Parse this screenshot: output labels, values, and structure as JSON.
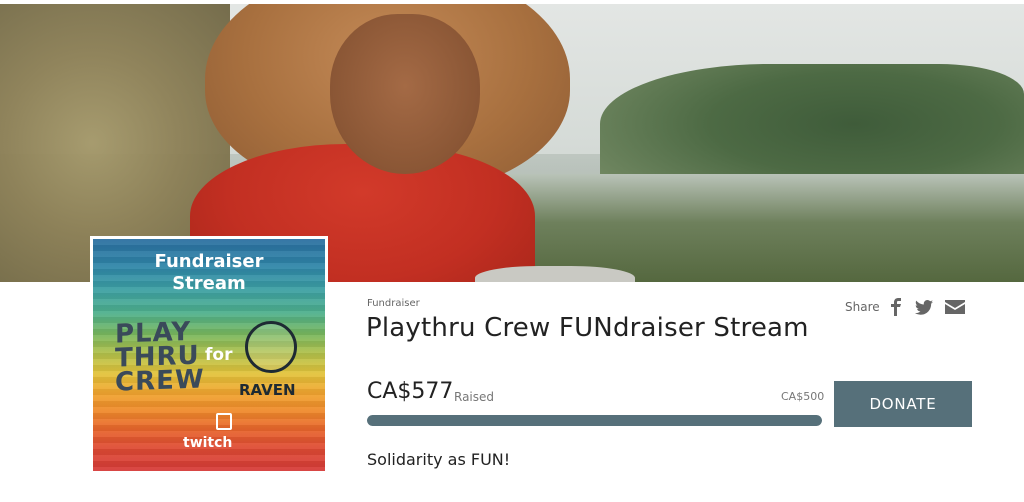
{
  "colors": {
    "accent": "#56707a",
    "text": "#222222",
    "muted": "#777777"
  },
  "poster": {
    "line1": "Fundraiser",
    "line2": "Stream",
    "play_lines": [
      "PLAY",
      "THRU",
      "CREW"
    ],
    "for_text": "for",
    "raven_text": "RAVEN",
    "twitch_text": "twitch"
  },
  "campaign": {
    "kind": "Fundraiser",
    "title": "Playthru Crew FUNdraiser Stream",
    "amount": "CA$577",
    "raised_label": "Raised",
    "goal": "CA$500",
    "progress": 1.0,
    "description": "Solidarity as FUN!"
  },
  "share": {
    "label": "Share",
    "icons": [
      "facebook-icon",
      "twitter-icon",
      "email-icon"
    ]
  },
  "donate_label": "DONATE"
}
